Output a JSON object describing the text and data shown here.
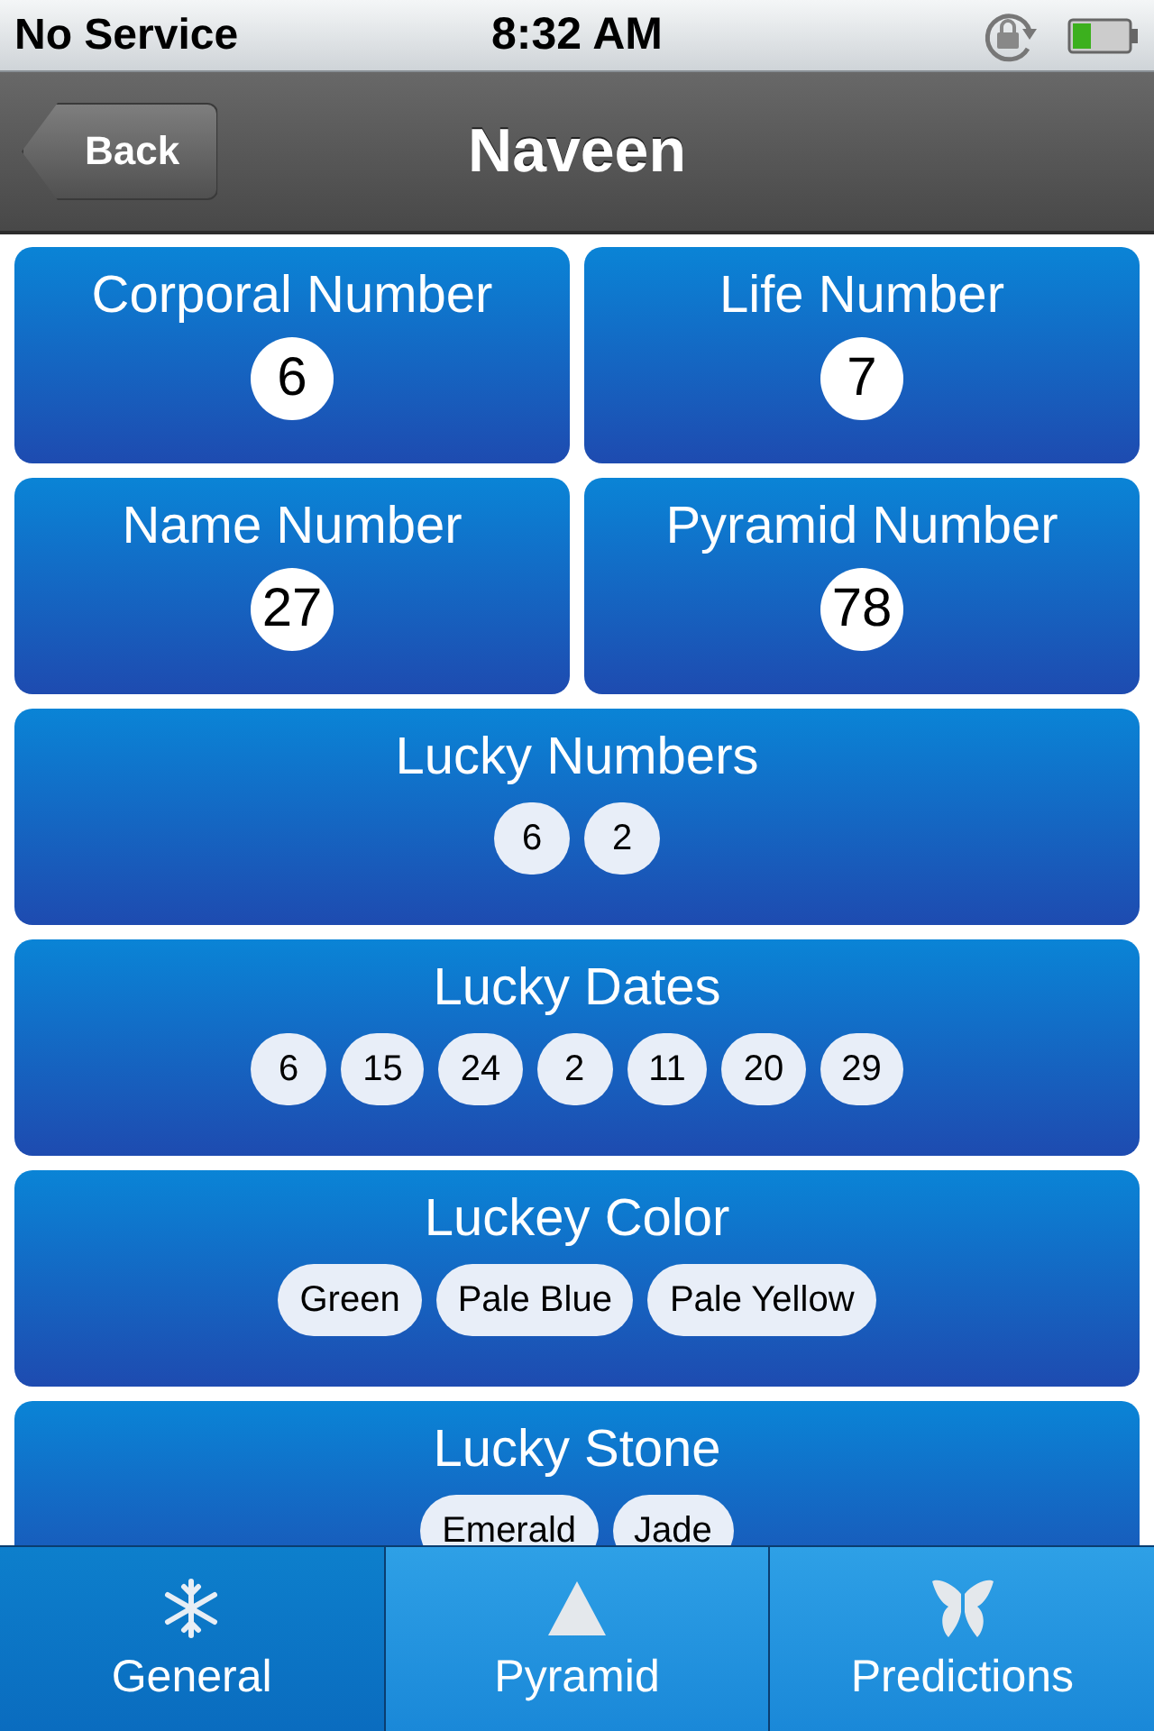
{
  "status_bar": {
    "carrier": "No Service",
    "time": "8:32 AM"
  },
  "nav_bar": {
    "back": "Back",
    "title": "Naveen"
  },
  "cards": [
    {
      "kind": "number",
      "title": "Corporal Number",
      "value": "6"
    },
    {
      "kind": "number",
      "title": "Life Number",
      "value": "7"
    },
    {
      "kind": "number",
      "title": "Name Number",
      "value": "27"
    },
    {
      "kind": "number",
      "title": "Pyramid Number",
      "value": "78"
    },
    {
      "kind": "chips",
      "title": "Lucky Numbers",
      "chips": [
        "6",
        "2"
      ]
    },
    {
      "kind": "chips",
      "title": "Lucky Dates",
      "chips": [
        "6",
        "15",
        "24",
        "2",
        "11",
        "20",
        "29"
      ]
    },
    {
      "kind": "chips",
      "title": "Luckey Color",
      "chips": [
        "Green",
        "Pale Blue",
        "Pale Yellow"
      ]
    },
    {
      "kind": "chips",
      "title": "Lucky Stone",
      "chips": [
        "Emerald",
        "Jade"
      ]
    }
  ],
  "tabs": [
    {
      "label": "General",
      "kind": "general",
      "selected": true
    },
    {
      "label": "Pyramid",
      "kind": "pyramid",
      "selected": false
    },
    {
      "label": "Predictions",
      "kind": "predictions",
      "selected": false
    }
  ]
}
